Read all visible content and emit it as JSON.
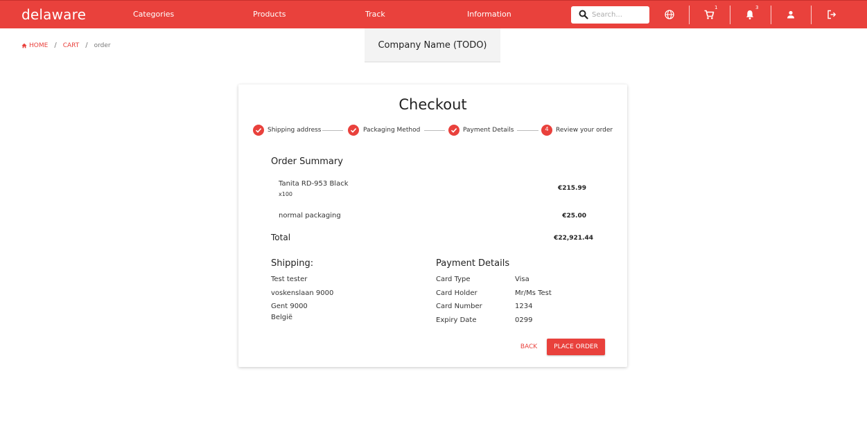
{
  "brand": {
    "logo": "delaware",
    "accent": "#e9413c"
  },
  "nav": {
    "categories": "Categories",
    "products": "Products",
    "track": "Track",
    "information": "Information"
  },
  "search": {
    "placeholder": "Search..."
  },
  "toolbar": {
    "cart_badge": "1",
    "notifications_badge": "3"
  },
  "icons": [
    "search-icon",
    "globe-icon",
    "cart-icon",
    "bell-icon",
    "user-icon",
    "logout-icon",
    "home-icon",
    "check-icon"
  ],
  "breadcrumb": {
    "home": "HOME",
    "cart": "CART",
    "current": "order"
  },
  "company": {
    "name": "Company Name (TODO)"
  },
  "checkout": {
    "title": "Checkout",
    "steps": [
      {
        "label": "Shipping address",
        "done": true
      },
      {
        "label": "Packaging Method",
        "done": true
      },
      {
        "label": "Payment Details",
        "done": true
      },
      {
        "label": "Review your order",
        "number": "4",
        "done": false
      }
    ],
    "summary": {
      "heading": "Order Summary",
      "items": [
        {
          "name": "Tanita RD-953 Black",
          "qty": "x100",
          "price": "€215.99"
        },
        {
          "name": "normal packaging",
          "price": "€25.00"
        }
      ],
      "total_label": "Total",
      "total_value": "€22,921.44"
    },
    "shipping": {
      "heading": "Shipping:",
      "lines": [
        "Test tester",
        "voskenslaan 9000",
        "Gent 9000",
        "België"
      ]
    },
    "payment": {
      "heading": "Payment Details",
      "rows": [
        {
          "label": "Card Type",
          "value": "Visa"
        },
        {
          "label": "Card Holder",
          "value": "Mr/Ms Test"
        },
        {
          "label": "Card Number",
          "value": "1234"
        },
        {
          "label": "Expiry Date",
          "value": "0299"
        }
      ]
    },
    "actions": {
      "back": "BACK",
      "place_order": "PLACE ORDER"
    }
  }
}
